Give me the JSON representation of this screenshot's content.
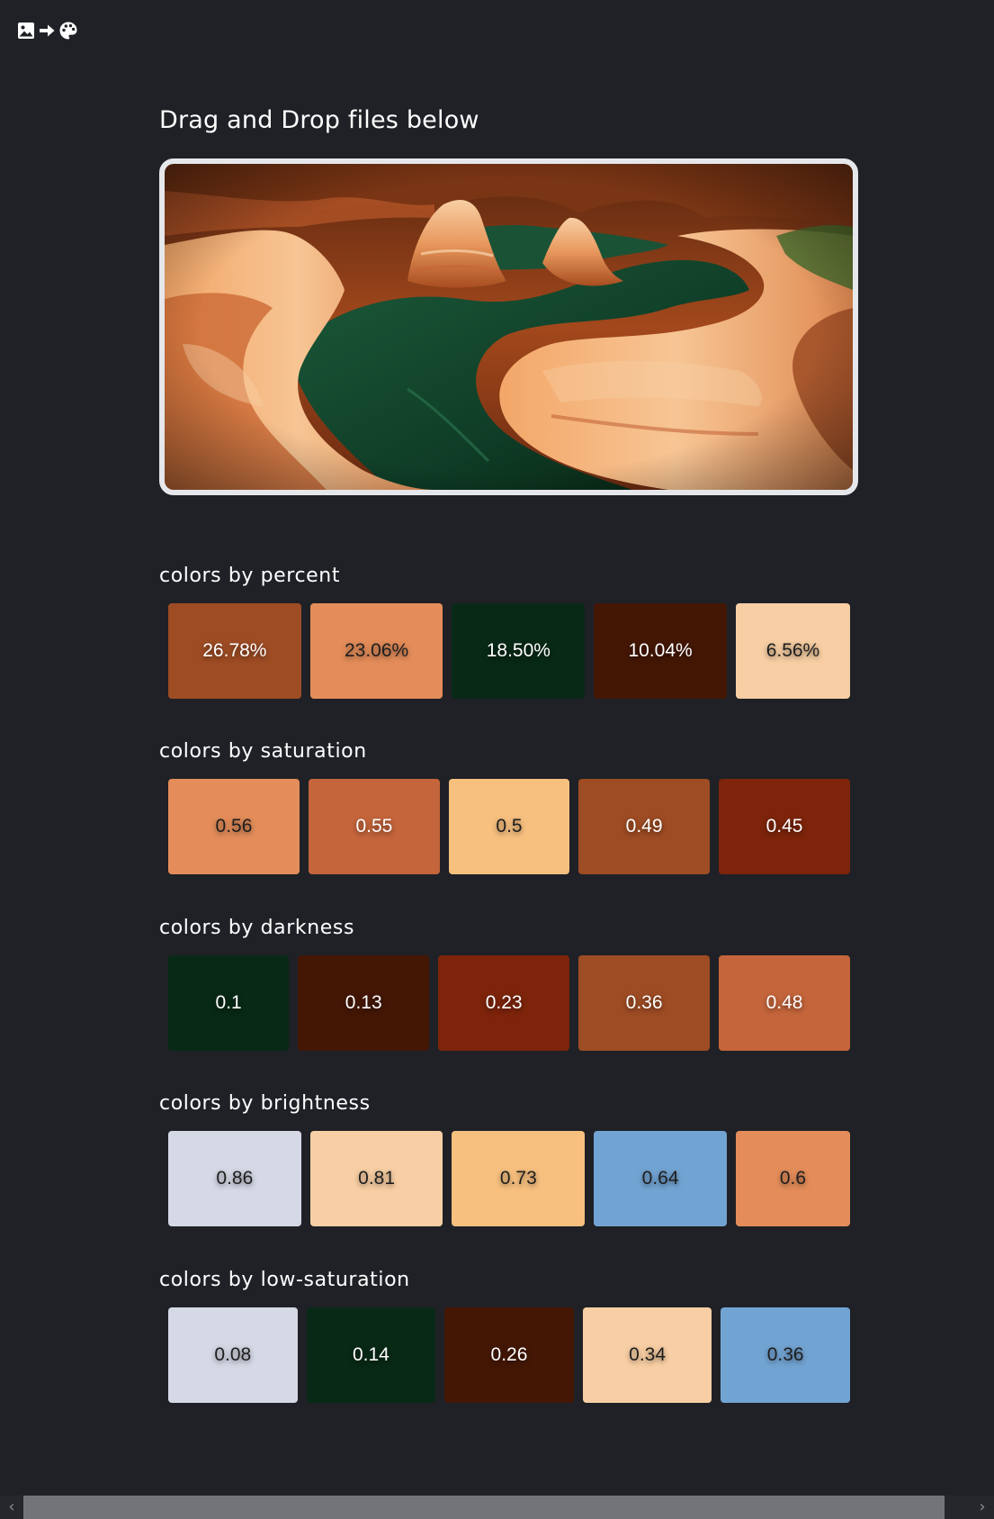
{
  "header": {
    "logo_icons": [
      "image-icon",
      "arrow-right-icon",
      "palette-icon"
    ]
  },
  "main": {
    "title": "Drag and Drop files below",
    "dropzone": {
      "image_subject": "canyon-river-photo"
    }
  },
  "sections": [
    {
      "heading": "colors by percent",
      "swatches": [
        {
          "label": "26.78%",
          "color": "#9e4c24",
          "text": "dark"
        },
        {
          "label": "23.06%",
          "color": "#e48d5a",
          "text": "light"
        },
        {
          "label": "18.50%",
          "color": "#082916",
          "text": "dark"
        },
        {
          "label": "10.04%",
          "color": "#441705",
          "text": "dark"
        },
        {
          "label": "6.56%",
          "color": "#f8cfa4",
          "text": "light"
        }
      ]
    },
    {
      "heading": "colors by saturation",
      "swatches": [
        {
          "label": "0.56",
          "color": "#e48d5a",
          "text": "light"
        },
        {
          "label": "0.55",
          "color": "#c5653b",
          "text": "dark"
        },
        {
          "label": "0.5",
          "color": "#f7c07f",
          "text": "light"
        },
        {
          "label": "0.49",
          "color": "#9e4c24",
          "text": "dark"
        },
        {
          "label": "0.45",
          "color": "#7d240b",
          "text": "dark"
        }
      ]
    },
    {
      "heading": "colors by darkness",
      "swatches": [
        {
          "label": "0.1",
          "color": "#082916",
          "text": "dark"
        },
        {
          "label": "0.13",
          "color": "#441705",
          "text": "dark"
        },
        {
          "label": "0.23",
          "color": "#7d240b",
          "text": "dark"
        },
        {
          "label": "0.36",
          "color": "#9e4c24",
          "text": "dark"
        },
        {
          "label": "0.48",
          "color": "#c5653b",
          "text": "dark"
        }
      ]
    },
    {
      "heading": "colors by brightness",
      "swatches": [
        {
          "label": "0.86",
          "color": "#d5d9e6",
          "text": "light"
        },
        {
          "label": "0.81",
          "color": "#f8cfa4",
          "text": "light"
        },
        {
          "label": "0.73",
          "color": "#f7c07f",
          "text": "light"
        },
        {
          "label": "0.64",
          "color": "#72a4d3",
          "text": "light"
        },
        {
          "label": "0.6",
          "color": "#e48d5a",
          "text": "light"
        }
      ]
    },
    {
      "heading": "colors by low-saturation",
      "swatches": [
        {
          "label": "0.08",
          "color": "#d5d9e6",
          "text": "light"
        },
        {
          "label": "0.14",
          "color": "#082916",
          "text": "dark"
        },
        {
          "label": "0.26",
          "color": "#441705",
          "text": "dark"
        },
        {
          "label": "0.34",
          "color": "#f8cfa4",
          "text": "light"
        },
        {
          "label": "0.36",
          "color": "#72a4d3",
          "text": "light"
        }
      ]
    }
  ],
  "scrollbar": {
    "left_arrow": "‹",
    "right_arrow": "›"
  }
}
